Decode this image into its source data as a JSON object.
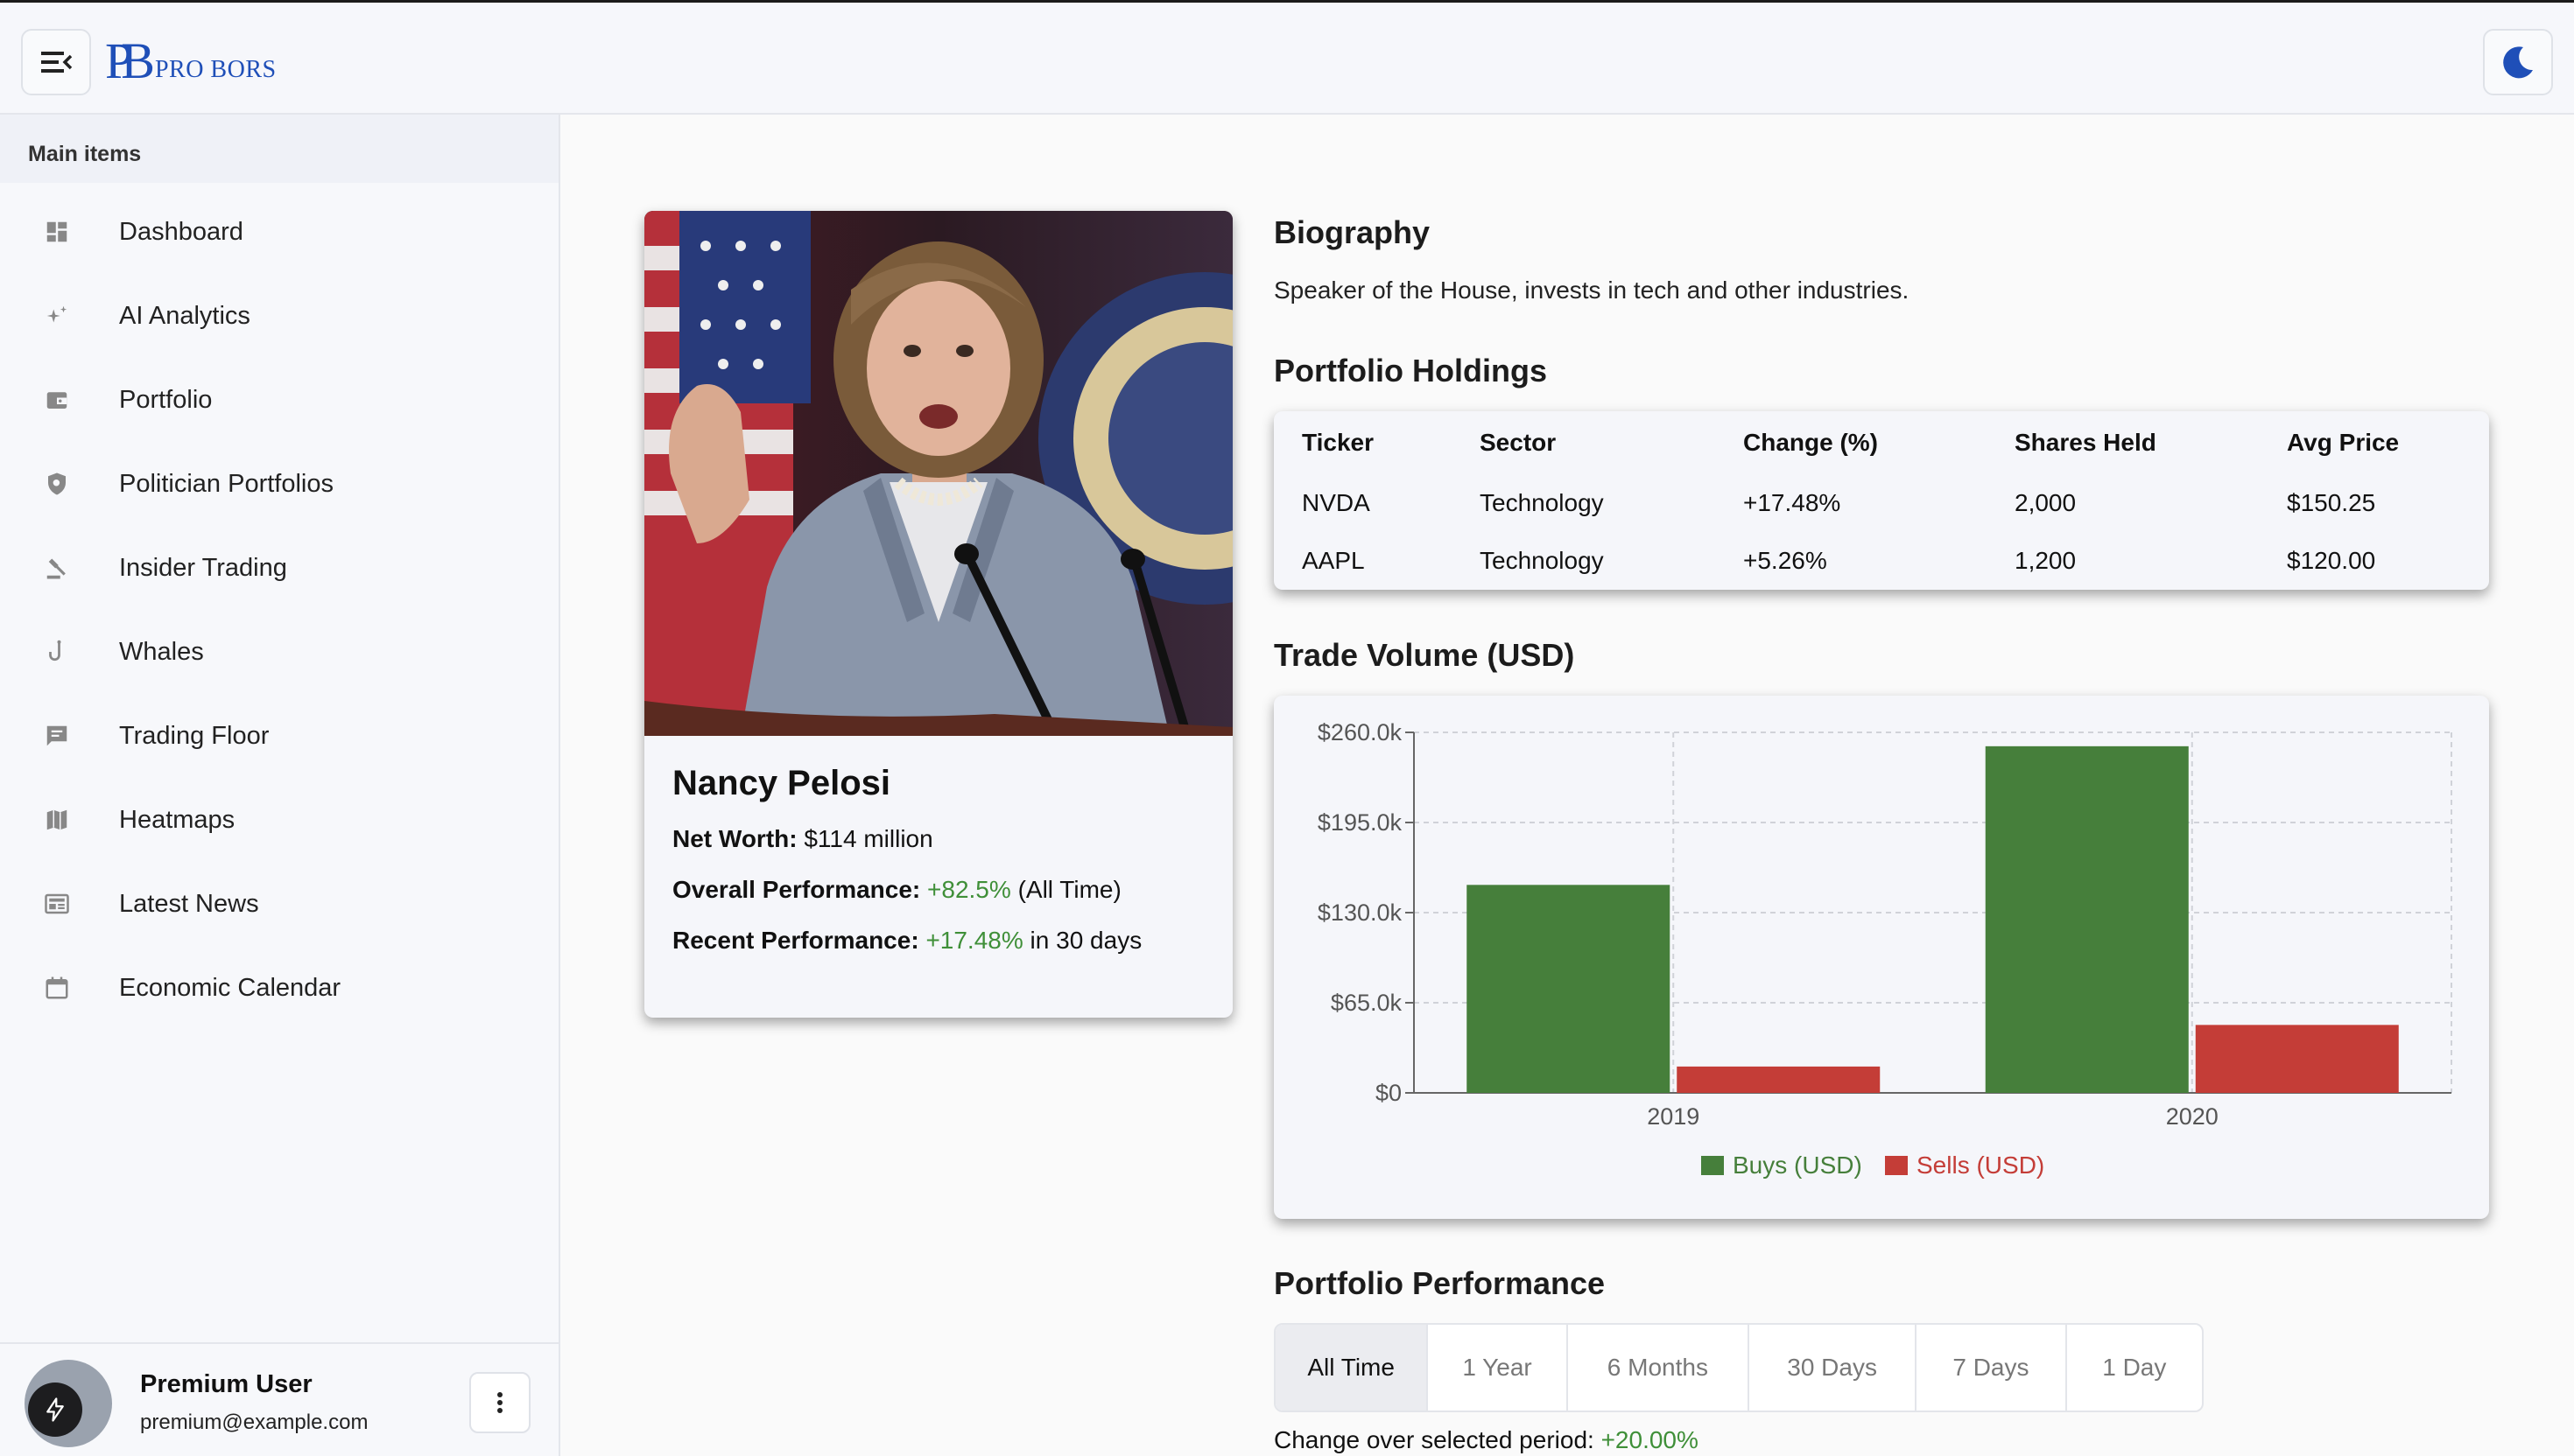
{
  "topbar": {
    "logo_mark": "PB",
    "logo_text": "PRO BORS"
  },
  "sidebar": {
    "section_label": "Main items",
    "items": [
      {
        "label": "Dashboard",
        "icon": "dashboard-icon"
      },
      {
        "label": "AI Analytics",
        "icon": "sparkle-icon"
      },
      {
        "label": "Portfolio",
        "icon": "wallet-icon"
      },
      {
        "label": "Politician Portfolios",
        "icon": "shield-icon"
      },
      {
        "label": "Insider Trading",
        "icon": "gavel-icon"
      },
      {
        "label": "Whales",
        "icon": "hook-icon"
      },
      {
        "label": "Trading Floor",
        "icon": "chat-icon"
      },
      {
        "label": "Heatmaps",
        "icon": "map-icon"
      },
      {
        "label": "Latest News",
        "icon": "newspaper-icon"
      },
      {
        "label": "Economic Calendar",
        "icon": "calendar-icon"
      }
    ],
    "user": {
      "name": "Premium User",
      "email": "premium@example.com"
    }
  },
  "profile": {
    "name": "Nancy Pelosi",
    "net_worth_label": "Net Worth:",
    "net_worth_value": "$114 million",
    "overall_label": "Overall Performance:",
    "overall_value": "+82.5%",
    "overall_suffix": "(All Time)",
    "recent_label": "Recent Performance:",
    "recent_value": "+17.48%",
    "recent_suffix": "in 30 days"
  },
  "biography": {
    "title": "Biography",
    "text": "Speaker of the House, invests in tech and other industries."
  },
  "holdings": {
    "title": "Portfolio Holdings",
    "headers": [
      "Ticker",
      "Sector",
      "Change (%)",
      "Shares Held",
      "Avg Price"
    ],
    "rows": [
      [
        "NVDA",
        "Technology",
        "+17.48%",
        "2,000",
        "$150.25"
      ],
      [
        "AAPL",
        "Technology",
        "+5.26%",
        "1,200",
        "$120.00"
      ]
    ]
  },
  "trade_volume": {
    "title": "Trade Volume (USD)"
  },
  "chart_data": {
    "type": "bar",
    "categories": [
      "2019",
      "2020"
    ],
    "series": [
      {
        "name": "Buys (USD)",
        "values": [
          150000,
          250000
        ],
        "color": "#467f3b"
      },
      {
        "name": "Sells (USD)",
        "values": [
          19000,
          49000
        ],
        "color": "#c43d37"
      }
    ],
    "ylim": [
      0,
      260000
    ],
    "yticks": [
      "$0",
      "$65.0k",
      "$130.0k",
      "$195.0k",
      "$260.0k"
    ],
    "ytick_values": [
      0,
      65000,
      130000,
      195000,
      260000
    ],
    "grid": true,
    "legend": "bottom-center"
  },
  "performance": {
    "title": "Portfolio Performance",
    "tabs": [
      "All Time",
      "1 Year",
      "6 Months",
      "30 Days",
      "7 Days",
      "1 Day"
    ],
    "active_tab": "All Time",
    "change_label": "Change over selected period:",
    "change_value": "+20.00%"
  },
  "colors": {
    "accent": "#1f4fb8",
    "positive": "#3f8f38",
    "buys": "#467f3b",
    "sells": "#c43d37"
  }
}
